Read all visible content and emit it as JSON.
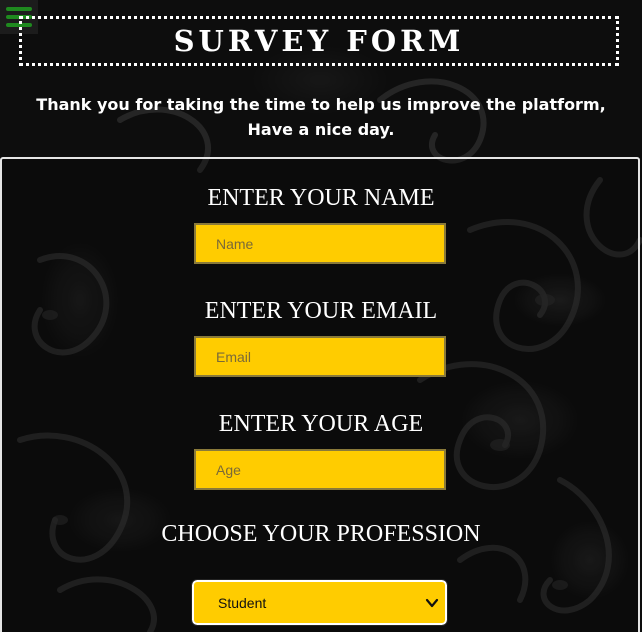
{
  "header": {
    "title": "SURVEY FORM",
    "subtitle_line1": "Thank you for taking the time to help us improve the platform,",
    "subtitle_line2": "Have a nice day."
  },
  "menu": {
    "icon": "hamburger-menu-icon",
    "color": "#1f8a1f"
  },
  "form": {
    "name": {
      "label": "ENTER YOUR NAME",
      "placeholder": "Name",
      "value": ""
    },
    "email": {
      "label": "ENTER YOUR EMAIL",
      "placeholder": "Email",
      "value": ""
    },
    "age": {
      "label": "ENTER YOUR AGE",
      "placeholder": "Age",
      "value": ""
    },
    "profession": {
      "label": "CHOOSE YOUR PROFESSION",
      "selected": "Student"
    }
  },
  "colors": {
    "accent": "#ffcc00",
    "background": "#0d0d0d",
    "text": "#ffffff"
  }
}
